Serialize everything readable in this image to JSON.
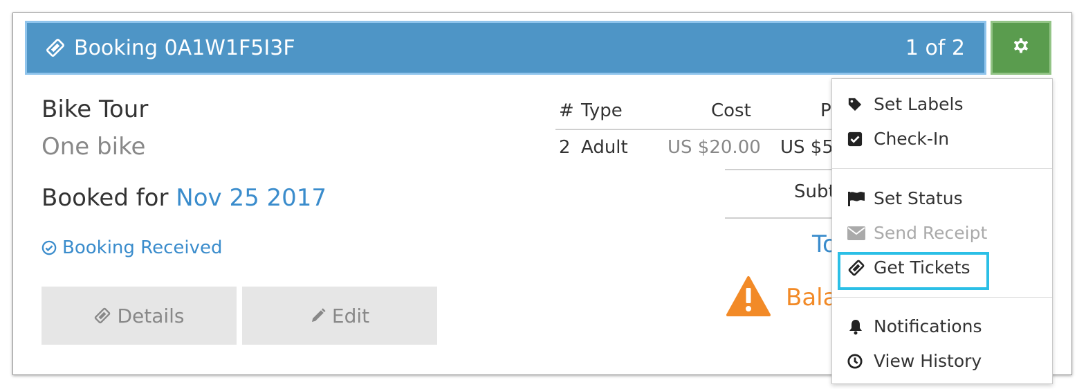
{
  "header": {
    "booking_label": "Booking 0A1W1F5I3F",
    "pager": "1 of 2",
    "colors": {
      "header_bg": "#4e95c6",
      "gear_bg": "#5a9c4e"
    }
  },
  "booking": {
    "title": "Bike Tour",
    "subtitle": "One bike",
    "booked_for_label": "Booked for",
    "booked_for_date": "Nov 25 2017",
    "status": "Booking Received"
  },
  "buttons": {
    "details": "Details",
    "edit": "Edit"
  },
  "table": {
    "headers": {
      "num": "#",
      "type": "Type",
      "cost": "Cost",
      "price": "P"
    },
    "rows": [
      {
        "num": "2",
        "type": "Adult",
        "cost": "US $20.00",
        "price": "US $5"
      }
    ],
    "subtotal_label": "Subt",
    "total_label": "To",
    "balance_label": "Bala"
  },
  "menu": {
    "items": [
      {
        "label": "Set Labels",
        "icon": "tag-icon"
      },
      {
        "label": "Check-In",
        "icon": "checkbox-icon"
      },
      {
        "label": "Set Status",
        "icon": "flag-icon"
      },
      {
        "label": "Send Receipt",
        "icon": "envelope-icon",
        "disabled": true
      },
      {
        "label": "Get Tickets",
        "icon": "ticket-icon",
        "highlighted": true
      },
      {
        "label": "Notifications",
        "icon": "bell-icon"
      },
      {
        "label": "View History",
        "icon": "clock-icon"
      }
    ]
  }
}
